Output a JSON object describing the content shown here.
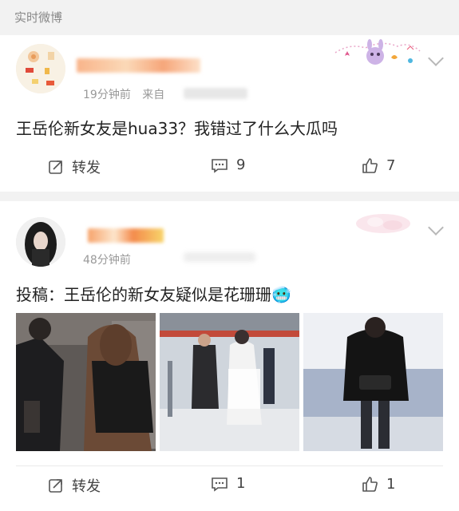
{
  "section": {
    "title": "实时微博"
  },
  "posts": [
    {
      "time": "19分钟前",
      "source_prefix": "来自",
      "text": "王岳伦新女友是hua33？我错过了什么大瓜吗",
      "actions": {
        "repost": "转发",
        "comments": "9",
        "likes": "7"
      }
    },
    {
      "time": "48分钟前",
      "text": "投稿：王岳伦的新女友疑似是花珊珊",
      "emoji": "🥶",
      "actions": {
        "repost": "转发",
        "comments": "1",
        "likes": "1"
      },
      "images": [
        "photo-1",
        "photo-2",
        "photo-3"
      ]
    }
  ],
  "icons": {
    "repost": "repost-icon",
    "comment": "comment-icon",
    "like": "thumbs-up-icon",
    "menu": "chevron-down-icon"
  },
  "colors": {
    "background": "#f2f2f2",
    "card": "#ffffff",
    "meta_text": "#999999",
    "body_text": "#222222"
  }
}
